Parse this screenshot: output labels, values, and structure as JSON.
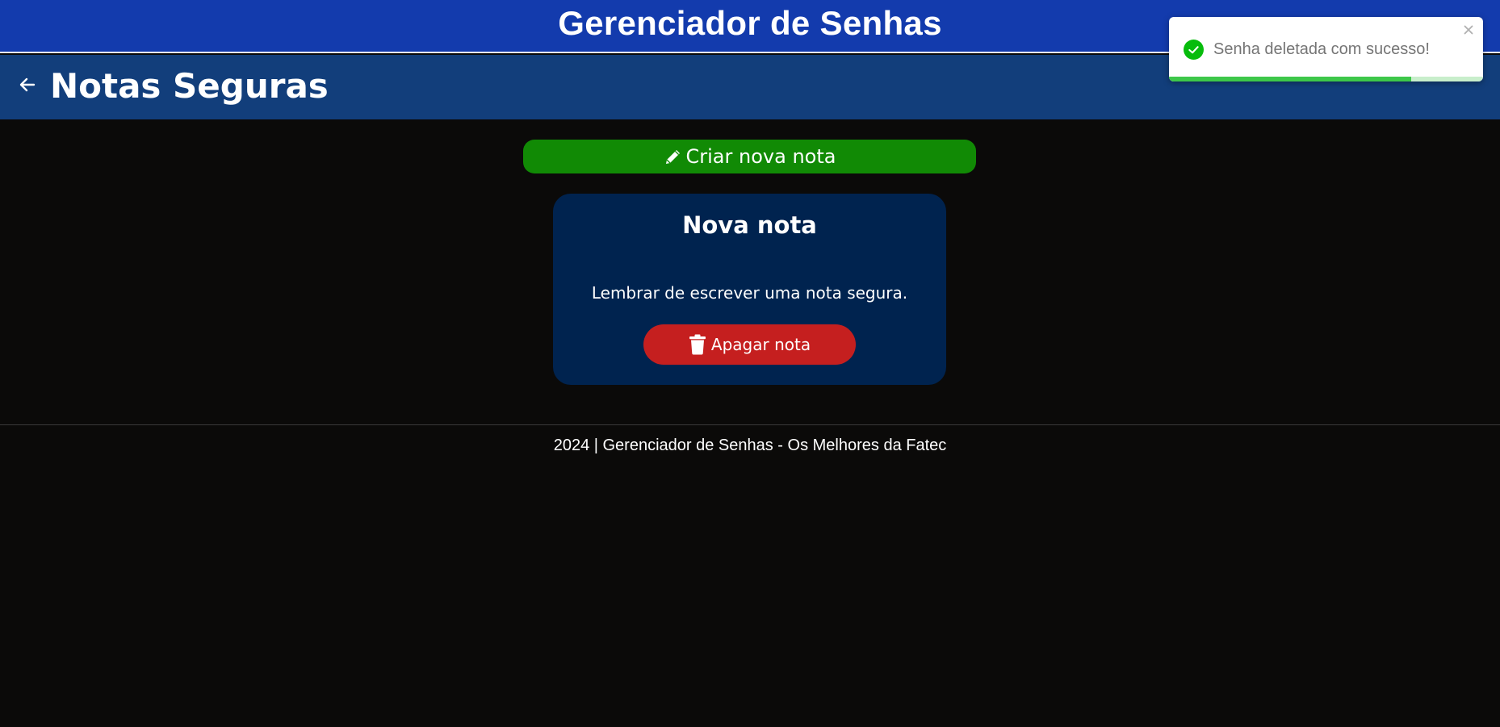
{
  "header": {
    "app_title": "Gerenciador de Senhas",
    "background_color": "#133bad"
  },
  "subheader": {
    "back_icon": "arrow-left-icon",
    "page_title": "Notas Seguras",
    "background_color": "#123e7b"
  },
  "toast": {
    "icon": "check-circle-icon",
    "message": "Senha deletada com sucesso!",
    "close_icon": "close-icon",
    "progress": 0.77,
    "accent_color": "#07bc0c"
  },
  "actions": {
    "create_icon": "pencil-icon",
    "create_label": "Criar nova nota",
    "create_color": "#118a05"
  },
  "notes": [
    {
      "title": "Nova nota",
      "body": "Lembrar de escrever uma nota segura.",
      "delete_icon": "trash-icon",
      "delete_label": "Apagar nota",
      "delete_color": "#c51f1f",
      "card_color": "#00234f"
    }
  ],
  "footer": {
    "text": "2024 | Gerenciador de Senhas - Os Melhores da Fatec"
  }
}
